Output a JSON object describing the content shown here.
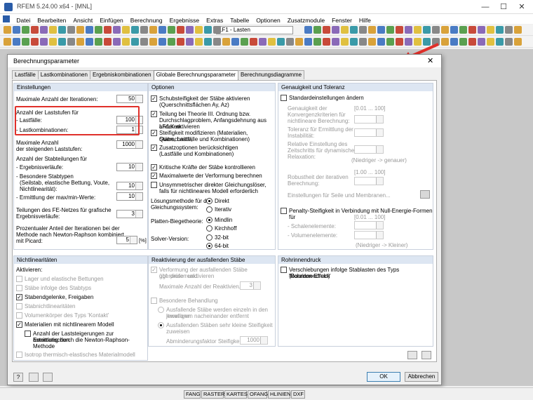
{
  "app": {
    "title": "RFEM 5.24.00 x64 - [MNL]"
  },
  "menu": [
    "Datei",
    "Bearbeiten",
    "Ansicht",
    "Einfügen",
    "Berechnung",
    "Ergebnisse",
    "Extras",
    "Tabelle",
    "Optionen",
    "Zusatzmodule",
    "Fenster",
    "Hilfe"
  ],
  "toolbar": {
    "loadcase": "LF1 - Lasten"
  },
  "dialog": {
    "title": "Berechnungsparameter",
    "tabs": [
      "Lastfälle",
      "Lastkombinationen",
      "Ergebniskombinationen",
      "Globale Berechnungsparameter",
      "Berechnungsdiagramme"
    ],
    "einstellungen": {
      "header": "Einstellungen",
      "max_iter_label": "Maximale Anzahl der Iterationen:",
      "max_iter": "50",
      "laststufen_label": "Anzahl der Laststufen für",
      "lastfaelle_label": "- Lastfälle:",
      "lastfaelle": "100",
      "lastkomb_label": "- Lastkombinationen:",
      "lastkomb": "1",
      "steigend_label1": "Maximale Anzahl",
      "steigend_label2": "der steigenden Laststufen:",
      "steigend": "1000",
      "stabteil_label": "Anzahl der Stabteilungen für",
      "ergverl_label": "- Ergebnisverläufe:",
      "ergverl": "10",
      "besonders_label1": "- Besondere Stabtypen",
      "besonders_label2": "(Seilstab, elastische Bettung, Voute,",
      "besonders_label3": "Nichtlinearität):",
      "besonders": "10",
      "maxmin_label": "- Ermittlung der max/min-Werte:",
      "maxmin": "10",
      "fe_label1": "Teilungen des FE-Netzes für grafische",
      "fe_label2": "Ergebnisverläufe:",
      "fe": "3",
      "picard_label1": "Prozentualer Anteil der Iterationen bei der",
      "picard_label2": "Methode nach Newton-Raphson kombiniert",
      "picard_label3": "mit Picard:",
      "picard": "5",
      "picard_unit": "[%]"
    },
    "optionen": {
      "header": "Optionen",
      "o1a": "Schubsteifigkeit der Stäbe aktivieren",
      "o1b": "(Querschnittsflächen Ay, Az)",
      "o2a": "Teilung bei Theorie III. Ordnung bzw.",
      "o2b": "Durchschlagproblem, Anfangsdehnung aus anderem",
      "o2c": "LF/LK aktivieren",
      "o3a": "Steifigkeit modifizieren (Materialien, Querschnitte,",
      "o3b": "Stäbe, Lastfälle und Kombinationen)",
      "o4a": "Zusatzoptionen berücksichtigen",
      "o4b": "(Lastfälle und Kombinationen)",
      "o5": "Kritische Kräfte der Stäbe kontrollieren",
      "o6": "Maximalwerte der Verformung berechnen",
      "o7a": "Unsymmetrischer direkter Gleichungslöser,",
      "o7b": "falls für nichtlineares Modell erforderlich",
      "loes_label1": "Lösungsmethode für das",
      "loes_label2": "Gleichungssystem:",
      "direkt": "Direkt",
      "iterativ": "Iterativ",
      "platten_label": "Platten-Biegetheorie:",
      "mindlin": "Mindlin",
      "kirchhoff": "Kirchhoff",
      "solver_label": "Solver-Version:",
      "bit32": "32-bit",
      "bit64": "64-bit"
    },
    "genauigkeit": {
      "header": "Genauigkeit und Toleranz",
      "std": "Standardeinstellungen ändern",
      "g1a": "Genauigkeit der",
      "g1b": "Konvergenzkriterien für",
      "g1c": "nichtlineare Berechnung:",
      "g1range": "[0.01 ... 100]",
      "g2a": "Toleranz für Ermittlung der",
      "g2b": "Instabilität:",
      "g3a": "Relative Einstellung des",
      "g3b": "Zeitschritts für dynamische",
      "g3c": "Relaxation:",
      "g3note": "(Niedriger -> genauer)",
      "g4range": "[1.00 ... 100]",
      "g4a": "Robustheit der iterativen",
      "g4b": "Berechnung:",
      "seile": "Einstellungen für Seile und Membranen...",
      "penalty": "Penalty-Steifigkeit in Verbindung mit Null-Energie-Formen für",
      "prange": "[0.01 ... 100]",
      "schale": "- Schalenelemente:",
      "volumen": "- Volumenelemente:",
      "pnote": "(Niedriger -> Kleiner)"
    },
    "nichtlin": {
      "header": "Nichtlinearitäten",
      "aktiv": "Aktivieren:",
      "n1": "Lager und elastische Bettungen",
      "n2": "Stäbe infolge des Stabtyps",
      "n3": "Stabendgelenke, Freigaben",
      "n4": "Stabnichtlinearitäten",
      "n5": "Volumenkörper des Typs 'Kontakt'",
      "n6": "Materialien mit nichtlinearem Modell",
      "n7a": "Anzahl der Laststeigerungen zur automatischen",
      "n7b": "Ermittlung durch die  Newton-Raphson-Methode",
      "n8": "Isotrop thermisch-elastisches Materialmodell"
    },
    "reaktiv": {
      "header": "Reaktivierung der ausfallenden Stäbe",
      "r1a": "Verformung der ausfallenden Stäbe überprüfen und",
      "r1b": "ggf. diese reaktivieren",
      "r2": "Maximale Anzahl der Reaktivierungen:",
      "r2v": "3",
      "r3": "Besondere Behandlung",
      "r4a": "Ausfallende Stäbe werden einzeln in den jeweiligen",
      "r4b": "Iterationen nacheinander entfernt",
      "r5a": "Ausfallenden Stäben sehr kleine Steifigkeit",
      "r5b": "zuweisen",
      "r6": "Abminderungsfaktor Steifigkeit",
      "r6v": "1000"
    },
    "rohr": {
      "header": "Rohrinnendruck",
      "c1a": "Verschiebungen infolge Stablasten des Typs 'Rohrinnendruck'",
      "c1b": "(Bourdon-Effekt)"
    },
    "ok": "OK",
    "cancel": "Abbrechen"
  },
  "status": [
    "FANG",
    "RASTER",
    "KARTES",
    "OFANG",
    "HLINIEN",
    "DXF"
  ]
}
